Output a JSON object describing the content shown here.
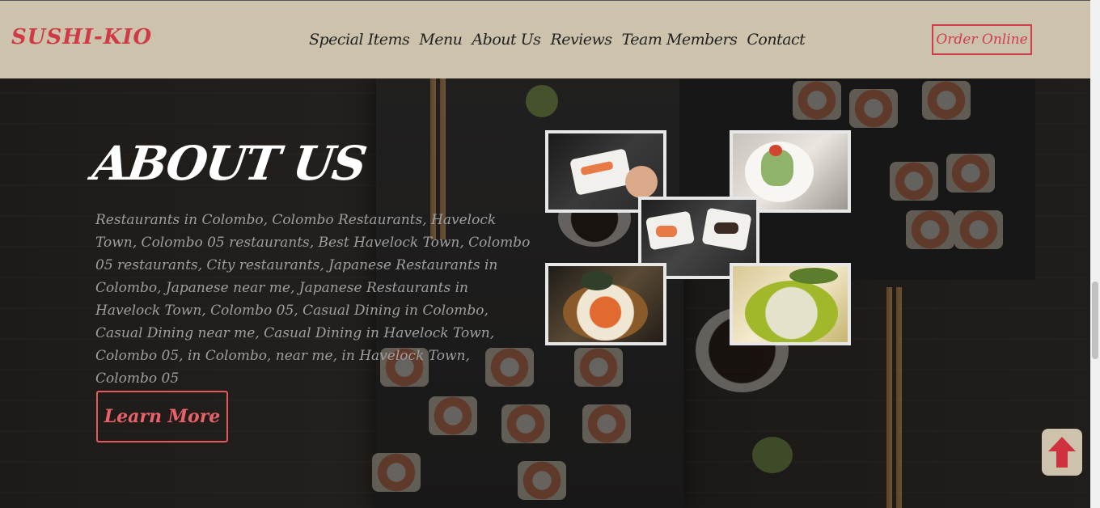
{
  "header": {
    "logo": "SUSHI-KIO",
    "nav": [
      "Special Items",
      "Menu",
      "About Us",
      "Reviews",
      "Team Members",
      "Contact"
    ],
    "order_label": "Order Online"
  },
  "about": {
    "title": "ABOUT US",
    "text": "Restaurants in Colombo, Colombo Restaurants, Havelock Town, Colombo 05 restaurants, Best Havelock Town, Colombo 05 restaurants, City restaurants, Japanese Restaurants in Colombo, Japanese near me, Japanese Restaurants in Havelock Town, Colombo 05, Casual Dining in Colombo, Casual Dining near me, Casual Dining in Havelock Town, Colombo 05, in Colombo, near me, in Havelock Town, Colombo 05",
    "learn_more": "Learn More"
  },
  "gallery": [
    "sushi-plate-photo",
    "salad-photo",
    "sushi-platter-photo",
    "sashimi-photo",
    "rice-ball-photo"
  ],
  "colors": {
    "accent": "#cf3d4a",
    "header_bg": "#cdc3ad",
    "learn_more": "#e05a5f"
  }
}
